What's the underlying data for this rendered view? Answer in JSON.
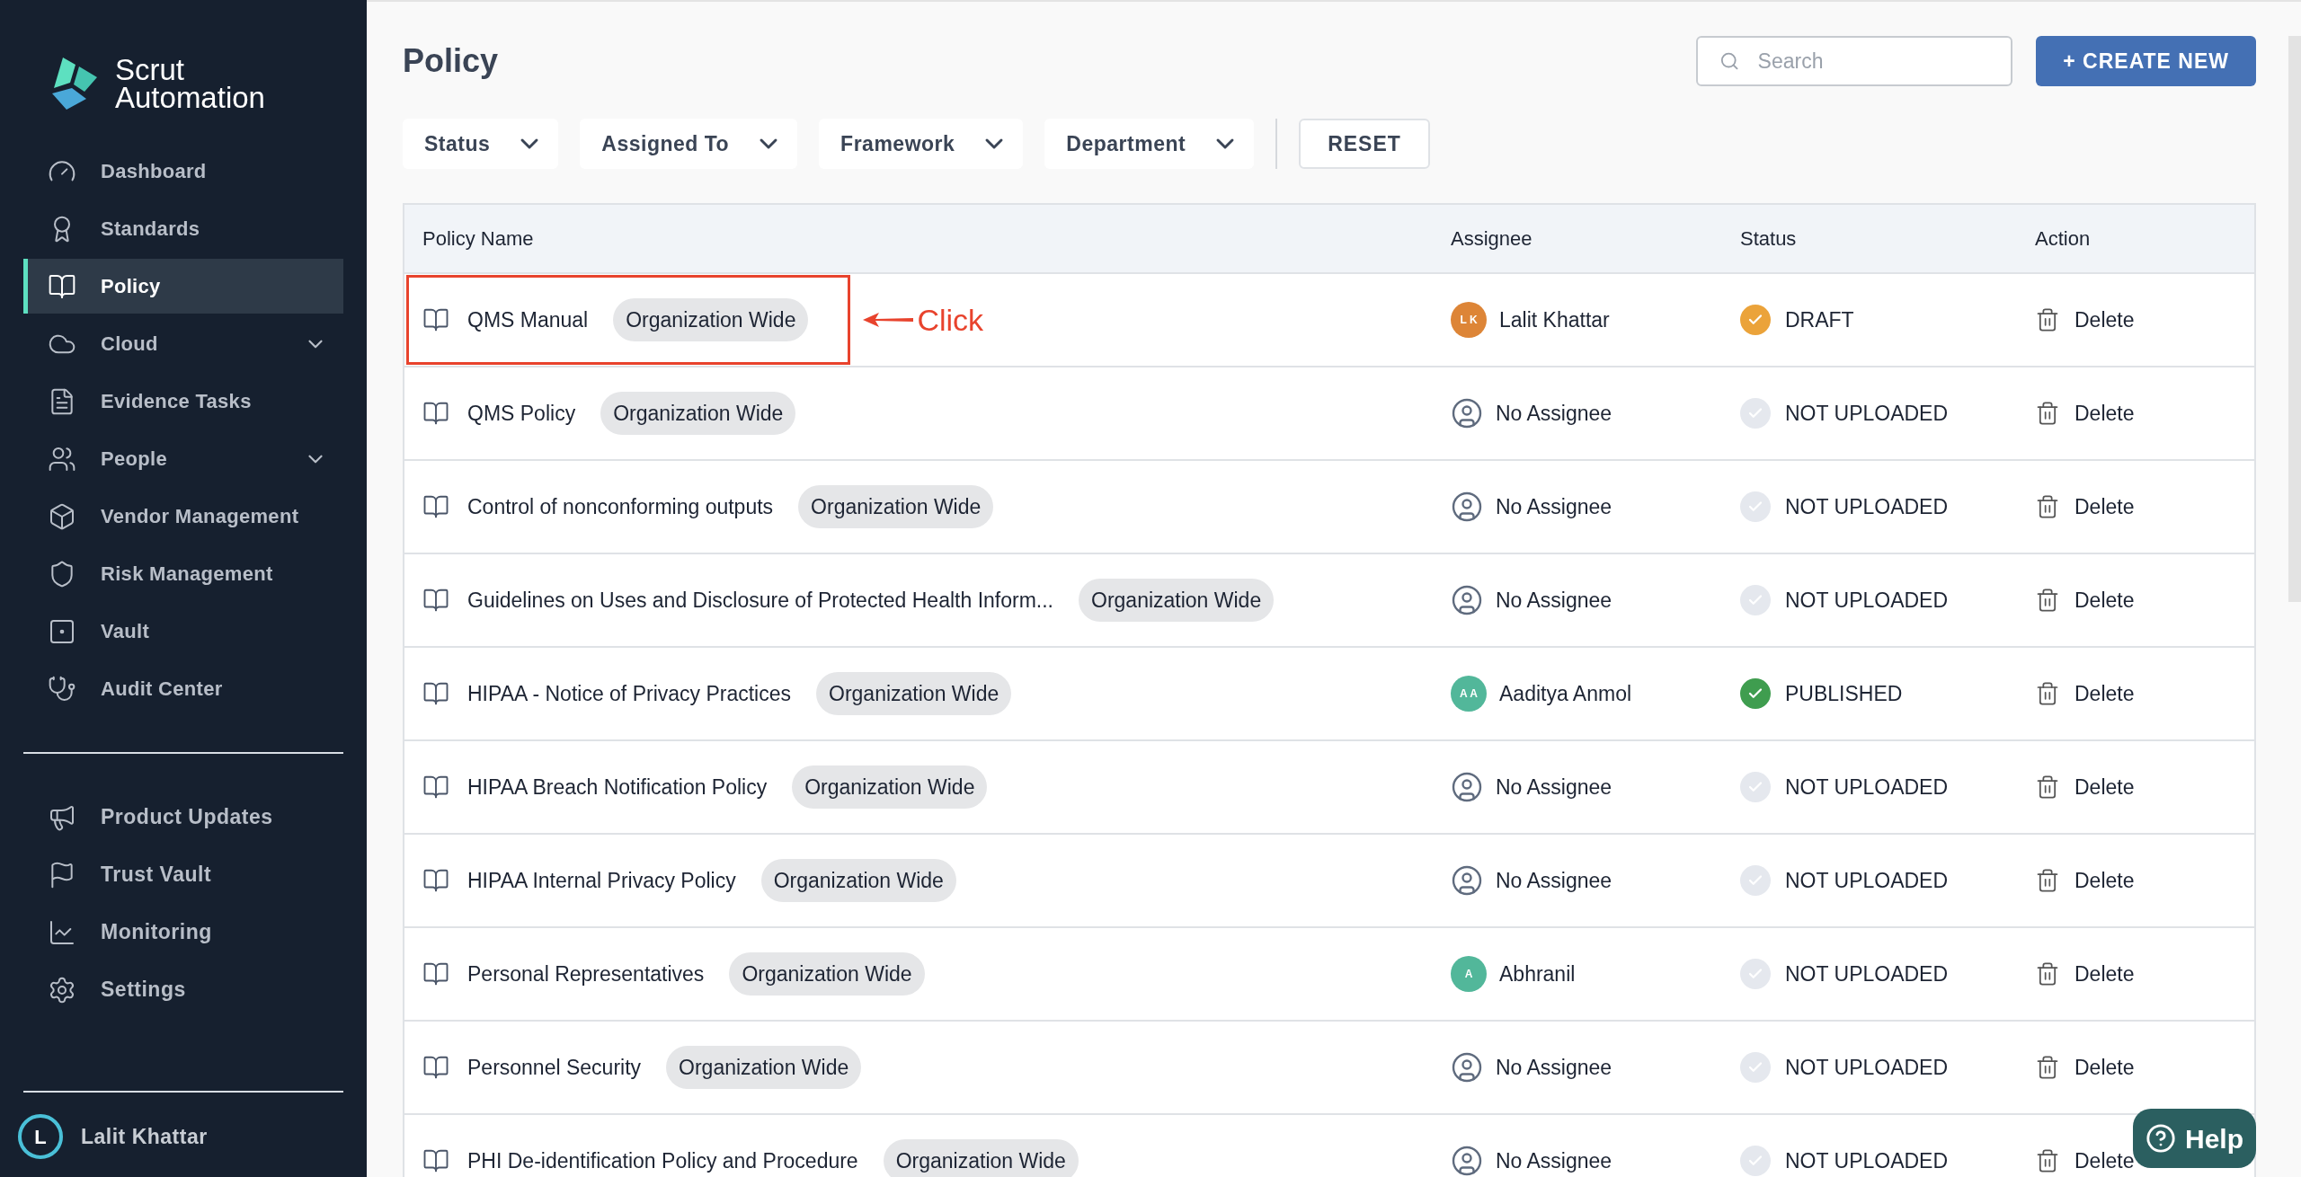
{
  "brand": {
    "name_line_1": "Scrut",
    "name_line_2": "Automation"
  },
  "sidebar": {
    "items": [
      {
        "label": "Dashboard",
        "selected": false,
        "expandable": false
      },
      {
        "label": "Standards",
        "selected": false,
        "expandable": false
      },
      {
        "label": "Policy",
        "selected": true,
        "expandable": false
      },
      {
        "label": "Cloud",
        "selected": false,
        "expandable": true
      },
      {
        "label": "Evidence Tasks",
        "selected": false,
        "expandable": false
      },
      {
        "label": "People",
        "selected": false,
        "expandable": true
      },
      {
        "label": "Vendor Management",
        "selected": false,
        "expandable": false
      },
      {
        "label": "Risk Management",
        "selected": false,
        "expandable": false
      },
      {
        "label": "Vault",
        "selected": false,
        "expandable": false
      },
      {
        "label": "Audit Center",
        "selected": false,
        "expandable": false
      }
    ],
    "bottom_items": [
      {
        "label": "Product Updates"
      },
      {
        "label": "Trust Vault"
      },
      {
        "label": "Monitoring"
      },
      {
        "label": "Settings"
      }
    ],
    "user": {
      "initial": "L",
      "name": "Lalit Khattar"
    }
  },
  "page": {
    "title": "Policy",
    "search": {
      "placeholder": "Search"
    },
    "create_button": "+ CREATE NEW",
    "filters": [
      "Status",
      "Assigned To",
      "Framework",
      "Department"
    ],
    "reset_button": "RESET"
  },
  "table": {
    "columns": [
      "Policy Name",
      "Assignee",
      "Status",
      "Action"
    ],
    "rows": [
      {
        "name": "QMS Manual",
        "tag": "Organization Wide",
        "highlighted": true,
        "assignee": {
          "kind": "avatar",
          "initials": "L K",
          "name": "Lalit Khattar",
          "color": "#dd8537"
        },
        "status": {
          "kind": "draft",
          "label": "DRAFT"
        },
        "action": "Delete"
      },
      {
        "name": "QMS Policy",
        "tag": "Organization Wide",
        "highlighted": false,
        "assignee": {
          "kind": "none",
          "name": "No Assignee"
        },
        "status": {
          "kind": "not_uploaded",
          "label": "NOT UPLOADED"
        },
        "action": "Delete"
      },
      {
        "name": "Control of nonconforming outputs",
        "tag": "Organization Wide",
        "highlighted": false,
        "assignee": {
          "kind": "none",
          "name": "No Assignee"
        },
        "status": {
          "kind": "not_uploaded",
          "label": "NOT UPLOADED"
        },
        "action": "Delete"
      },
      {
        "name": "Guidelines on Uses and Disclosure of Protected Health Inform...",
        "tag": "Organization Wide",
        "highlighted": false,
        "assignee": {
          "kind": "none",
          "name": "No Assignee"
        },
        "status": {
          "kind": "not_uploaded",
          "label": "NOT UPLOADED"
        },
        "action": "Delete"
      },
      {
        "name": "HIPAA - Notice of Privacy Practices",
        "tag": "Organization Wide",
        "highlighted": false,
        "assignee": {
          "kind": "avatar",
          "initials": "A A",
          "name": "Aaditya Anmol",
          "color": "#52b79a"
        },
        "status": {
          "kind": "published",
          "label": "PUBLISHED"
        },
        "action": "Delete"
      },
      {
        "name": "HIPAA Breach Notification Policy",
        "tag": "Organization Wide",
        "highlighted": false,
        "assignee": {
          "kind": "none",
          "name": "No Assignee"
        },
        "status": {
          "kind": "not_uploaded",
          "label": "NOT UPLOADED"
        },
        "action": "Delete"
      },
      {
        "name": "HIPAA Internal Privacy Policy",
        "tag": "Organization Wide",
        "highlighted": false,
        "assignee": {
          "kind": "none",
          "name": "No Assignee"
        },
        "status": {
          "kind": "not_uploaded",
          "label": "NOT UPLOADED"
        },
        "action": "Delete"
      },
      {
        "name": "Personal Representatives",
        "tag": "Organization Wide",
        "highlighted": false,
        "assignee": {
          "kind": "avatar",
          "initials": "A",
          "name": "Abhranil",
          "color": "#52b79a"
        },
        "status": {
          "kind": "not_uploaded",
          "label": "NOT UPLOADED"
        },
        "action": "Delete"
      },
      {
        "name": "Personnel Security",
        "tag": "Organization Wide",
        "highlighted": false,
        "assignee": {
          "kind": "none",
          "name": "No Assignee"
        },
        "status": {
          "kind": "not_uploaded",
          "label": "NOT UPLOADED"
        },
        "action": "Delete"
      },
      {
        "name": "PHI De-identification Policy and Procedure",
        "tag": "Organization Wide",
        "highlighted": false,
        "assignee": {
          "kind": "none",
          "name": "No Assignee"
        },
        "status": {
          "kind": "not_uploaded",
          "label": "NOT UPLOADED"
        },
        "action": "Delete"
      }
    ]
  },
  "callout": "Click",
  "help_button": "Help"
}
